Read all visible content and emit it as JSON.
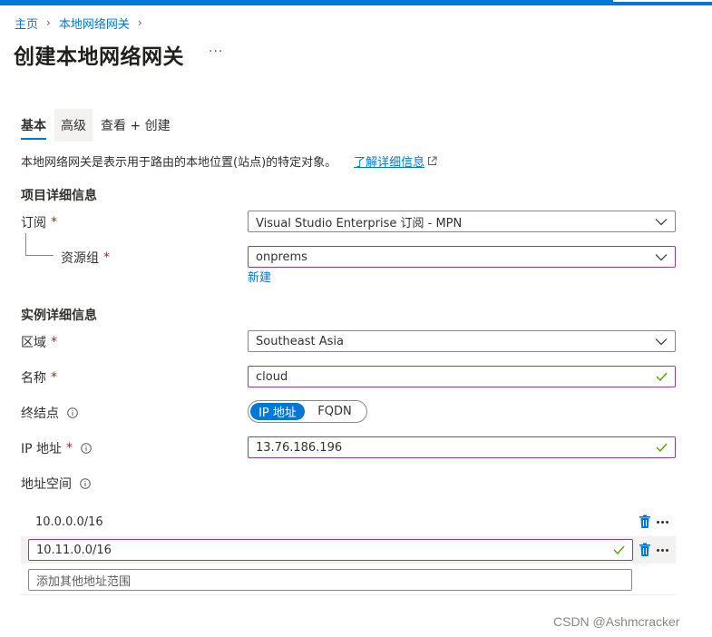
{
  "breadcrumb": {
    "home": "主页",
    "parent": "本地网络网关"
  },
  "page": {
    "title": "创建本地网络网关",
    "more": "···"
  },
  "tabs": [
    {
      "label": "基本",
      "active": true
    },
    {
      "label": "高级",
      "active": false
    },
    {
      "label": "查看 + 创建",
      "active": false
    }
  ],
  "description": {
    "text": "本地网络网关是表示用于路由的本地位置(站点)的特定对象。",
    "link": "了解详细信息"
  },
  "project": {
    "heading": "项目详细信息",
    "subscription_label": "订阅",
    "subscription_value": "Visual Studio Enterprise 订阅 - MPN",
    "resource_group_label": "资源组",
    "resource_group_value": "onprems",
    "create_new": "新建"
  },
  "instance": {
    "heading": "实例详细信息",
    "region_label": "区域",
    "region_value": "Southeast Asia",
    "name_label": "名称",
    "name_value": "cloud",
    "endpoint_label": "终结点",
    "endpoint_options": [
      "IP 地址",
      "FQDN"
    ],
    "endpoint_selected": "IP 地址",
    "ip_label": "IP 地址",
    "ip_value": "13.76.186.196",
    "address_space_label": "地址空间",
    "required_mark": "*"
  },
  "address_space": {
    "rows": [
      "10.0.0.0/16"
    ],
    "editing_value": "10.11.0.0/16",
    "add_placeholder": "添加其他地址范围"
  },
  "watermark": "CSDN @Ashmcracker",
  "colors": {
    "accent": "#0078d4",
    "required": "#a4262c",
    "valid": "#57a300",
    "focus_border": "#8c3ea0"
  }
}
